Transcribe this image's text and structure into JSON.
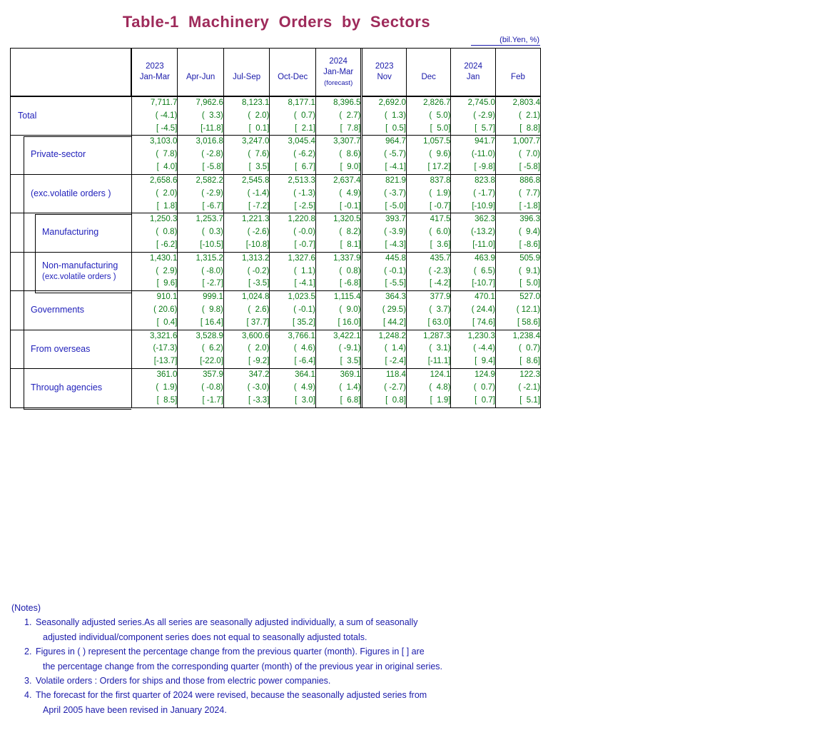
{
  "title": "Table-1  Machinery  Orders  by  Sectors",
  "unit_label": "(bil.Yen, %)",
  "colors": {
    "title": "#9e2a5a",
    "label_text": "#2222bb",
    "value_text": "#0a7a16",
    "border": "#000000"
  },
  "header": {
    "corner_label": "",
    "columns": [
      {
        "year": "2023",
        "period": "Jan-Mar",
        "note": ""
      },
      {
        "year": "",
        "period": "Apr-Jun",
        "note": ""
      },
      {
        "year": "",
        "period": "Jul-Sep",
        "note": ""
      },
      {
        "year": "",
        "period": "Oct-Dec",
        "note": ""
      },
      {
        "year": "2024",
        "period": "Jan-Mar",
        "note": "(forecast)"
      },
      {
        "year": "2023",
        "period": "Nov",
        "note": ""
      },
      {
        "year": "",
        "period": "Dec",
        "note": ""
      },
      {
        "year": "2024",
        "period": "Jan",
        "note": ""
      },
      {
        "year": "",
        "period": "Feb",
        "note": ""
      }
    ]
  },
  "rows": [
    {
      "label": "Total",
      "sublabel": "",
      "indent": 0,
      "values": [
        "7,711.7",
        "7,962.6",
        "8,123.1",
        "8,177.1",
        "8,396.5",
        "2,692.0",
        "2,826.7",
        "2,745.0",
        "2,803.4"
      ],
      "qoq": [
        "( -4.1)",
        "(  3.3)",
        "(  2.0)",
        "(  0.7)",
        "(  2.7)",
        "(  1.3)",
        "(  5.0)",
        "( -2.9)",
        "(  2.1)"
      ],
      "yoy": [
        "[ -4.5]",
        "[-11.8]",
        "[  0.1]",
        "[  2.1]",
        "[  7.8]",
        "[  0.5]",
        "[  5.0]",
        "[  5.7]",
        "[  8.8]"
      ]
    },
    {
      "label": "Private-sector",
      "sublabel": "",
      "indent": 1,
      "values": [
        "3,103.0",
        "3,016.8",
        "3,247.0",
        "3,045.4",
        "3,307.7",
        "964.7",
        "1,057.5",
        "941.7",
        "1,007.7"
      ],
      "qoq": [
        "(  7.8)",
        "( -2.8)",
        "(  7.6)",
        "( -6.2)",
        "(  8.6)",
        "( -5.7)",
        "(  9.6)",
        "(-11.0)",
        "(  7.0)"
      ],
      "yoy": [
        "[  4.0]",
        "[ -5.8]",
        "[  3.5]",
        "[  6.7]",
        "[  9.0]",
        "[ -4.1]",
        "[ 17.2]",
        "[ -9.8]",
        "[ -5.8]"
      ]
    },
    {
      "label": "(exc.volatile orders )",
      "sublabel": "",
      "indent": 1,
      "values": [
        "2,658.6",
        "2,582.2",
        "2,545.8",
        "2,513.3",
        "2,637.4",
        "821.9",
        "837.8",
        "823.8",
        "886.8"
      ],
      "qoq": [
        "(  2.0)",
        "( -2.9)",
        "( -1.4)",
        "( -1.3)",
        "(  4.9)",
        "( -3.7)",
        "(  1.9)",
        "( -1.7)",
        "(  7.7)"
      ],
      "yoy": [
        "[  1.8]",
        "[ -6.7]",
        "[ -7.2]",
        "[ -2.5]",
        "[ -0.1]",
        "[ -5.0]",
        "[ -0.7]",
        "[-10.9]",
        "[ -1.8]"
      ]
    },
    {
      "label": "Manufacturing",
      "sublabel": "",
      "indent": 2,
      "values": [
        "1,250.3",
        "1,253.7",
        "1,221.3",
        "1,220.8",
        "1,320.5",
        "393.7",
        "417.5",
        "362.3",
        "396.3"
      ],
      "qoq": [
        "(  0.8)",
        "(  0.3)",
        "( -2.6)",
        "( -0.0)",
        "(  8.2)",
        "( -3.9)",
        "(  6.0)",
        "(-13.2)",
        "(  9.4)"
      ],
      "yoy": [
        "[ -6.2]",
        "[-10.5]",
        "[-10.8]",
        "[ -0.7]",
        "[  8.1]",
        "[ -4.3]",
        "[  3.6]",
        "[-11.0]",
        "[ -8.6]"
      ]
    },
    {
      "label": "Non-manufacturing",
      "sublabel": "(exc.volatile orders )",
      "indent": 2,
      "values": [
        "1,430.1",
        "1,315.2",
        "1,313.2",
        "1,327.6",
        "1,337.9",
        "445.8",
        "435.7",
        "463.9",
        "505.9"
      ],
      "qoq": [
        "(  2.9)",
        "( -8.0)",
        "( -0.2)",
        "(  1.1)",
        "(  0.8)",
        "( -0.1)",
        "( -2.3)",
        "(  6.5)",
        "(  9.1)"
      ],
      "yoy": [
        "[  9.6]",
        "[ -2.7]",
        "[ -3.5]",
        "[ -4.1]",
        "[ -6.8]",
        "[ -5.5]",
        "[ -4.2]",
        "[-10.7]",
        "[  5.0]"
      ]
    },
    {
      "label": "Governments",
      "sublabel": "",
      "indent": 1,
      "values": [
        "910.1",
        "999.1",
        "1,024.8",
        "1,023.5",
        "1,115.4",
        "364.3",
        "377.9",
        "470.1",
        "527.0"
      ],
      "qoq": [
        "( 20.6)",
        "(  9.8)",
        "(  2.6)",
        "( -0.1)",
        "(  9.0)",
        "( 29.5)",
        "(  3.7)",
        "( 24.4)",
        "( 12.1)"
      ],
      "yoy": [
        "[  0.4]",
        "[ 16.4]",
        "[ 37.7]",
        "[ 35.2]",
        "[ 16.0]",
        "[ 44.2]",
        "[ 63.0]",
        "[ 74.6]",
        "[ 58.6]"
      ]
    },
    {
      "label": "From overseas",
      "sublabel": "",
      "indent": 1,
      "values": [
        "3,321.6",
        "3,528.9",
        "3,600.6",
        "3,766.1",
        "3,422.1",
        "1,248.2",
        "1,287.3",
        "1,230.3",
        "1,238.4"
      ],
      "qoq": [
        "(-17.3)",
        "(  6.2)",
        "(  2.0)",
        "(  4.6)",
        "( -9.1)",
        "(  1.4)",
        "(  3.1)",
        "( -4.4)",
        "(  0.7)"
      ],
      "yoy": [
        "[-13.7]",
        "[-22.0]",
        "[ -9.2]",
        "[ -6.4]",
        "[  3.5]",
        "[ -2.4]",
        "[-11.1]",
        "[  9.4]",
        "[  8.6]"
      ]
    },
    {
      "label": "Through agencies",
      "sublabel": "",
      "indent": 1,
      "values": [
        "361.0",
        "357.9",
        "347.2",
        "364.1",
        "369.1",
        "118.4",
        "124.1",
        "124.9",
        "122.3"
      ],
      "qoq": [
        "(  1.9)",
        "( -0.8)",
        "( -3.0)",
        "(  4.9)",
        "(  1.4)",
        "( -2.7)",
        "(  4.8)",
        "(  0.7)",
        "( -2.1)"
      ],
      "yoy": [
        "[  8.5]",
        "[ -1.7]",
        "[ -3.3]",
        "[  3.0]",
        "[  6.8]",
        "[  0.8]",
        "[  1.9]",
        "[  0.7]",
        "[  5.1]"
      ]
    }
  ],
  "notes": {
    "heading": "(Notes)",
    "items": [
      {
        "num": "1.",
        "line1": "Seasonally adjusted series.As all series are seasonally adjusted individually, a sum of seasonally",
        "line2": "adjusted individual/component series does not equal to seasonally adjusted totals."
      },
      {
        "num": "2.",
        "line1": "Figures in ( ) represent the percentage change from the previous quarter (month). Figures in [ ] are",
        "line2": "the percentage change from the corresponding quarter (month) of the previous year in original series."
      },
      {
        "num": "3.",
        "line1": "Volatile orders : Orders for ships and those from electric power companies.",
        "line2": ""
      },
      {
        "num": "4.",
        "line1": "The forecast for the first quarter of 2024 were revised, because the seasonally adjusted series from",
        "line2": "April 2005 have been revised in January 2024."
      }
    ]
  }
}
